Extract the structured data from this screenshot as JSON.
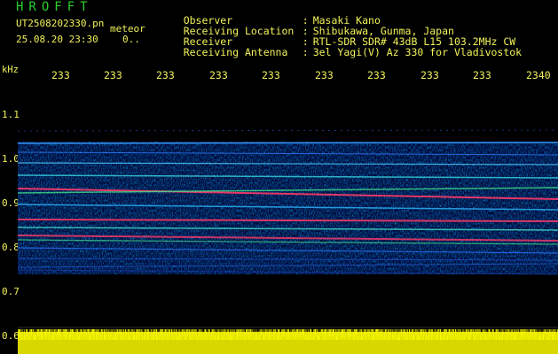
{
  "header": {
    "app_title": "HROFFT",
    "file_name": "UT2508202330.pn",
    "mode": "meteor",
    "timestamp": "25.08.20 23:30",
    "count": "0.."
  },
  "info": [
    {
      "key": "Observer",
      "value": "Masaki Kano"
    },
    {
      "key": "Receiving Location",
      "value": "Shibukawa, Gunma, Japan"
    },
    {
      "key": "Receiver",
      "value": "RTL-SDR SDR# 43dB L15 103.2MHz CW"
    },
    {
      "key": "Receiving Antenna",
      "value": "3el Yagi(V) Az 330 for Vladivostok"
    }
  ],
  "axis": {
    "unit": "kHz",
    "x_ticks": [
      "233",
      "233",
      "233",
      "233",
      "233",
      "233",
      "233",
      "233",
      "233",
      "2340"
    ],
    "y_ticks": [
      "1.1",
      "1.0",
      "0.9",
      "0.8",
      "0.7",
      "0.6"
    ]
  },
  "colors": {
    "text": "#f2f25a",
    "title": "#2bd12b",
    "background": "#000000",
    "noise_floor": "#ffff00"
  }
}
